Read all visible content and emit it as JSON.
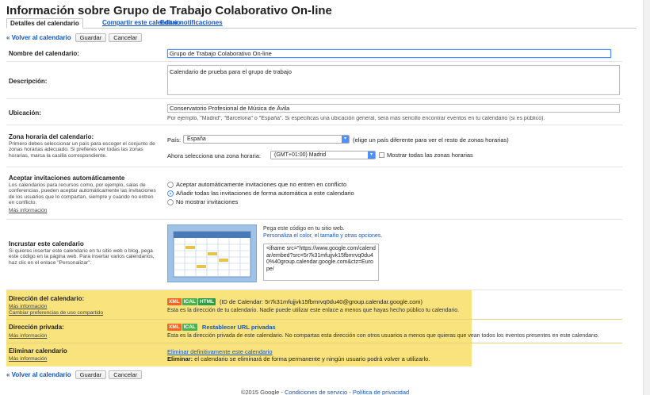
{
  "page_title": "Información sobre Grupo de Trabajo Colaborativo On-line",
  "tabs": [
    {
      "label": "Detalles del calendario"
    },
    {
      "label": "Compartir este calendario"
    },
    {
      "label": "Editar notificaciones"
    }
  ],
  "nav": {
    "back": "« Volver al calendario",
    "save": "Guardar",
    "cancel": "Cancelar"
  },
  "name": {
    "label": "Nombre del calendario:",
    "value": "Grupo de Trabajo Colaborativo On-line"
  },
  "description": {
    "label": "Descripción:",
    "value": "Calendario de prueba para el grupo de trabajo"
  },
  "location": {
    "label": "Ubicación:",
    "value": "Conservatorio Profesional de Música de Ávila",
    "hint": "Por ejemplo, \"Madrid\", \"Barcelona\" o \"España\". Si especificas una ubicación general, será más sencillo encontrar eventos en tu calendario (si es público)."
  },
  "timezone": {
    "label": "Zona horaria del calendario:",
    "help": "Primero debes seleccionar un país para escoger el conjunto de zonas horarias adecuado. Si prefieres ver todas las zonas horarias, marca la casilla correspondiente.",
    "country_label": "País:",
    "country_value": "España",
    "country_hint": "(elige un país diferente para ver el resto de zonas horarias)",
    "zone_label": "Ahora selecciona una zona horaria:",
    "zone_value": "(GMT+01:00) Madrid",
    "show_all": "Mostrar todas las zonas horarias"
  },
  "invitations": {
    "label": "Aceptar invitaciones automáticamente",
    "help": "Los calendarios para recursos como, por ejemplo, salas de conferencias, pueden aceptar automáticamente las invitaciones de los usuarios que lo compartan, siempre y cuando no entren en conflicto.",
    "more": "Más información",
    "options": [
      "Aceptar automáticamente invitaciones que no entren en conflicto",
      "Añadir todas las invitaciones de forma automática a este calendario",
      "No mostrar invitaciones"
    ],
    "selected_index": 1
  },
  "embed": {
    "label": "Incrustar este calendario",
    "help": "Si quieres insertar este calendario en tu sitio web o blog, pega este código en la página web. Para insertar varios calendarios, haz clic en el enlace \"Personalizar\".",
    "paste": "Pega este código en tu sitio web.",
    "customize": "Personaliza el color, el tamaño y otras opciones.",
    "code": "<iframe src=\"https://www.google.com/calendar/embed?src=5r7k31mfujjvk15fbmrvq0du40%40group.calendar.google.com&ctz=Europe/"
  },
  "address": {
    "label": "Dirección del calendario:",
    "more": "Más información",
    "change": "Cambiar preferencias de uso compartido",
    "badges": [
      "XML",
      "ICAL",
      "HTML"
    ],
    "id_text": "(ID de Calendar: 5r7k31mfujjvk15fbmrvq0du40@group.calendar.google.com)",
    "desc": "Esta es la dirección de tu calendario. Nadie puede utilizar este enlace a menos que hayas hecho público tu calendario."
  },
  "private": {
    "label": "Dirección privada:",
    "more": "Más información",
    "badges": [
      "XML",
      "ICAL"
    ],
    "reset": "Restablecer URL privadas",
    "desc": "Esta es la dirección privada de este calendario. No compartas esta dirección con otros usuarios a menos que quieras que vean todos los eventos presentes en este calendario."
  },
  "delete": {
    "label": "Eliminar calendario",
    "more": "Más información",
    "link": "Eliminar definitivamente este calendario",
    "warn_bold": "Eliminar:",
    "warn_text": " el calendario se eliminará de forma permanente y ningún usuario podrá volver a utilizarlo."
  },
  "footer": {
    "copyright": "©2015 Google - ",
    "terms": "Condiciones de servicio",
    "sep": " - ",
    "privacy": "Política de privacidad"
  },
  "colors": {
    "link": "#1155cc",
    "highlight": "#f9e37c",
    "focus": "#4d90fe",
    "xml": "#f26522",
    "ical": "#4caf50"
  }
}
